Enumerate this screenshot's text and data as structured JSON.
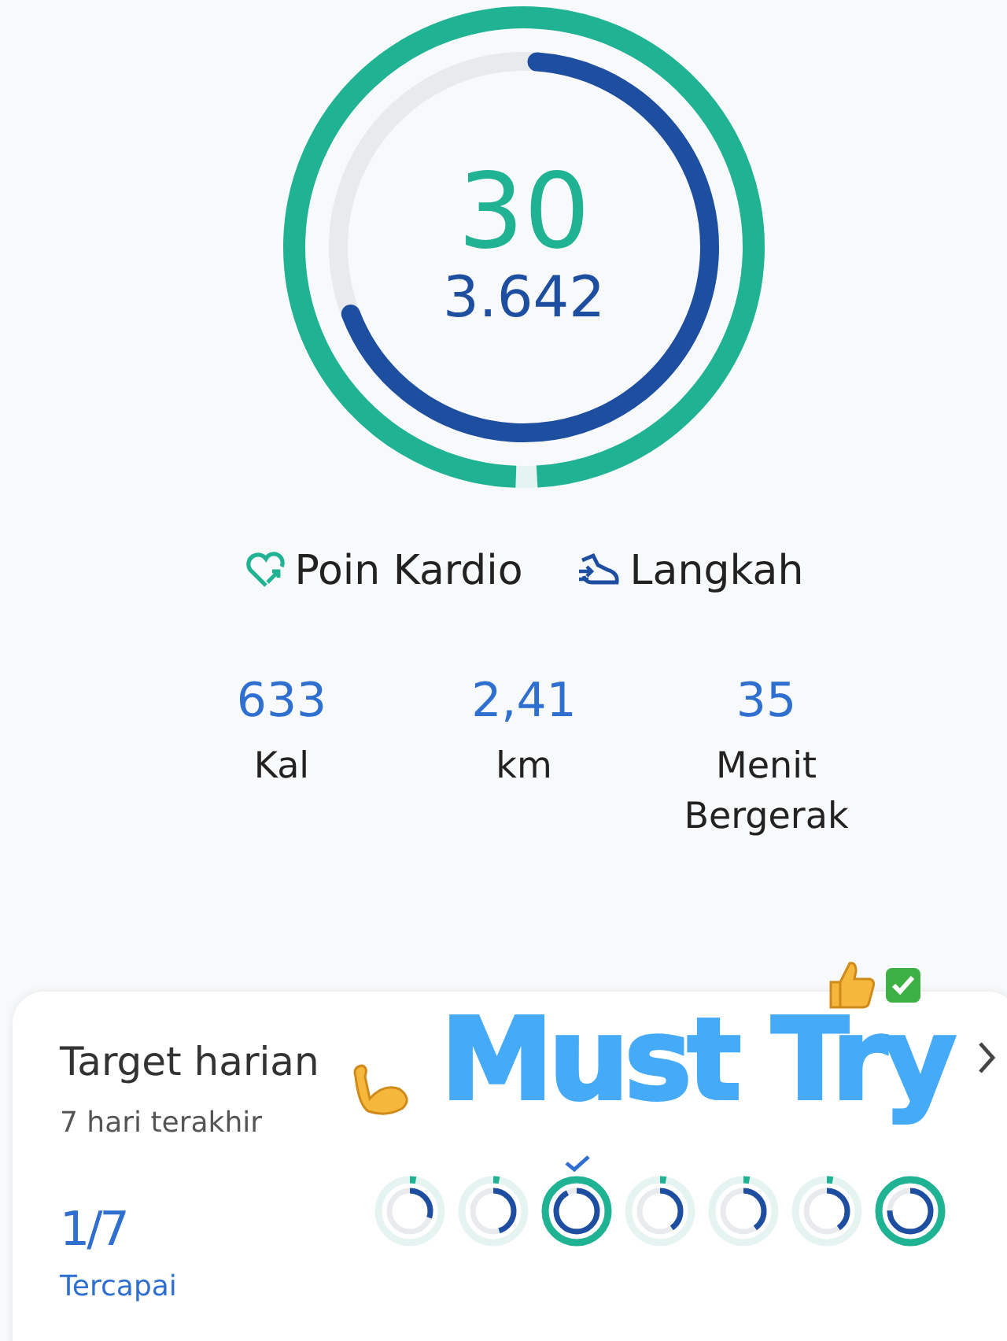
{
  "ring": {
    "cardio": {
      "value": "30",
      "level": 1
    },
    "steps": {
      "value": "3.642",
      "level": 0.68
    }
  },
  "legend": [
    {
      "kind": "cardio",
      "label": "Poin Kardio"
    },
    {
      "kind": "steps",
      "label": "Langkah"
    }
  ],
  "stats": [
    {
      "value": "633",
      "label": "Kal"
    },
    {
      "value": "2,41",
      "label": "km"
    },
    {
      "value": "35",
      "label": "Menit Bergerak"
    }
  ],
  "daily_target": {
    "title": "Target harian",
    "subtitle": "7 hari terakhir",
    "score": "1/7",
    "score_label": "Tercapai",
    "days": [
      {
        "checked": false,
        "cardio": {
          "level": 0.03
        },
        "steps": {
          "level": 0.3
        }
      },
      {
        "checked": false,
        "cardio": {
          "level": 0.03
        },
        "steps": {
          "level": 0.45
        }
      },
      {
        "checked": true,
        "cardio": {
          "level": 1
        },
        "steps": {
          "level": 0.92
        }
      },
      {
        "checked": false,
        "cardio": {
          "level": 0.03
        },
        "steps": {
          "level": 0.4
        }
      },
      {
        "checked": false,
        "cardio": {
          "level": 0.03
        },
        "steps": {
          "level": 0.4
        }
      },
      {
        "checked": false,
        "cardio": {
          "level": 0.03
        },
        "steps": {
          "level": 0.4
        }
      },
      {
        "checked": false,
        "cardio": {
          "level": 1
        },
        "steps": {
          "level": 0.75
        }
      }
    ]
  },
  "sticker": {
    "text": "Must Try"
  }
}
